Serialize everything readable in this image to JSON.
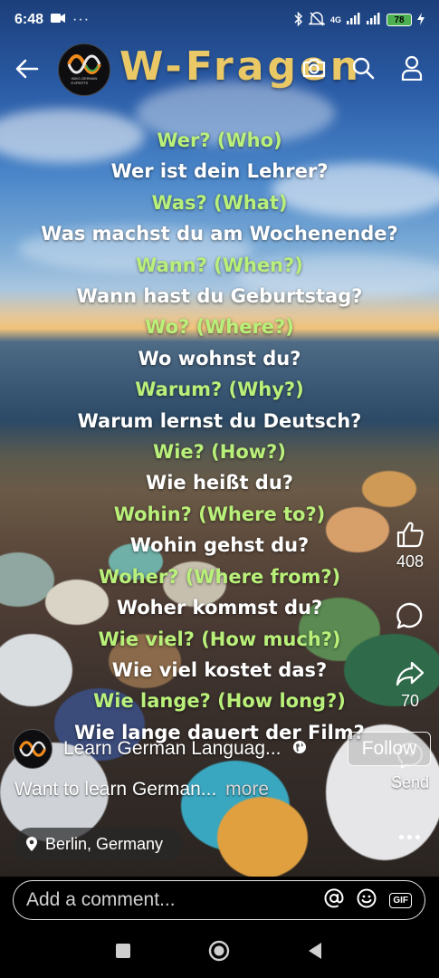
{
  "status_bar": {
    "time": "6:48",
    "network": "4G",
    "battery": "78"
  },
  "topbar": {
    "title": "W-Fragen",
    "logo_text": "INDO-GERMAN EXPERTS"
  },
  "phrases": [
    {
      "text": "Wer? (Who)",
      "kind": "q"
    },
    {
      "text": "Wer ist dein Lehrer?",
      "kind": "a"
    },
    {
      "text": "Was? (What)",
      "kind": "q"
    },
    {
      "text": "Was machst du am Wochenende?",
      "kind": "a"
    },
    {
      "text": "Wann? (When?)",
      "kind": "q"
    },
    {
      "text": "Wann hast du Geburtstag?",
      "kind": "a"
    },
    {
      "text": "Wo? (Where?)",
      "kind": "q"
    },
    {
      "text": "Wo wohnst du?",
      "kind": "a"
    },
    {
      "text": "Warum? (Why?)",
      "kind": "q"
    },
    {
      "text": "Warum lernst du Deutsch?",
      "kind": "a"
    },
    {
      "text": "Wie? (How?)",
      "kind": "q"
    },
    {
      "text": "Wie heißt du?",
      "kind": "a"
    },
    {
      "text": "Wohin? (Where to?)",
      "kind": "q"
    },
    {
      "text": "Wohin gehst du?",
      "kind": "a"
    },
    {
      "text": "Woher? (Where from?)",
      "kind": "q"
    },
    {
      "text": "Woher kommst du?",
      "kind": "a"
    },
    {
      "text": "Wie viel? (How much?)",
      "kind": "q"
    },
    {
      "text": "Wie viel kostet das?",
      "kind": "a"
    },
    {
      "text": "Wie lange? (How long?)",
      "kind": "q"
    },
    {
      "text": "Wie lange dauert der Film?",
      "kind": "a"
    }
  ],
  "rail": {
    "like_count": "408",
    "share_count": "70",
    "send_label": "Send"
  },
  "post": {
    "author_name": "Learn German Languag...",
    "follow_label": "Follow",
    "caption": "Want to learn German...",
    "more_label": "more",
    "location": "Berlin, Germany"
  },
  "comment": {
    "placeholder": "Add a comment..."
  },
  "icons": {
    "back": "arrow-left-icon",
    "camera": "camera-icon",
    "search": "search-icon",
    "profile": "person-icon",
    "like": "thumbs-up-icon",
    "comment": "comment-bubble-icon",
    "share": "share-arrow-icon",
    "send": "messenger-icon",
    "globe": "globe-icon",
    "location": "location-pin-icon",
    "more": "more-dots-icon",
    "mention": "at-sign-icon",
    "emoji": "smiley-icon",
    "gif": "gif-icon"
  },
  "colors": {
    "title": "#e9c865",
    "question_text": "#b9f07a",
    "answer_text": "#ffffff"
  }
}
